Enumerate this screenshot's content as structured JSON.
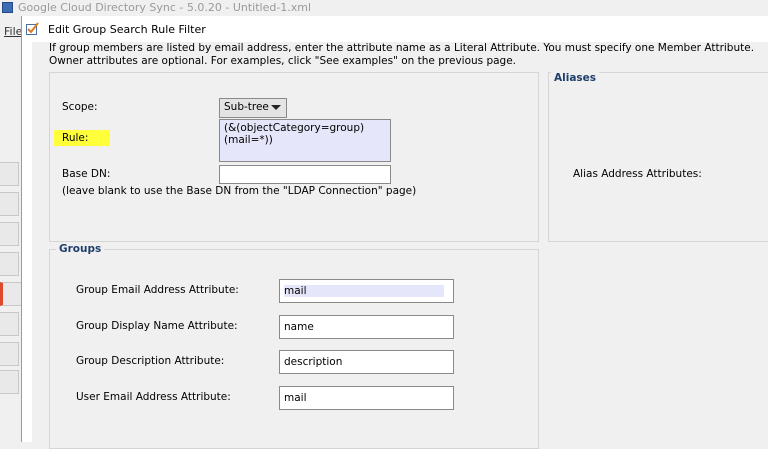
{
  "app": {
    "title": "Google Cloud Directory Sync - 5.0.20 - Untitled-1.xml",
    "menu_file": "File"
  },
  "dialog": {
    "title": "Edit Group Search Rule Filter",
    "intro_line1": "If group members are listed by email address, enter the attribute name as a Literal Attribute. You must specify one Member Attribute.",
    "intro_line2": "Owner attributes are optional. For examples, click \"See examples\" on the previous page."
  },
  "search": {
    "scope_label": "Scope:",
    "scope_value": "Sub-tree",
    "rule_label": "Rule:",
    "rule_value": "(&(objectCategory=group)(mail=*))",
    "base_dn_label": "Base DN:",
    "base_dn_value": "",
    "base_dn_hint": "(leave blank to use the Base DN from the \"LDAP Connection\" page)"
  },
  "aliases": {
    "title": "Aliases",
    "alias_label": "Alias Address Attributes:"
  },
  "groups": {
    "title": "Groups",
    "fields": [
      {
        "label": "Group Email Address Attribute:",
        "value": "mail"
      },
      {
        "label": "Group Display Name Attribute:",
        "value": "name"
      },
      {
        "label": "Group Description Attribute:",
        "value": "description"
      },
      {
        "label": "User Email Address Attribute:",
        "value": "mail"
      }
    ]
  },
  "colors": {
    "highlight": "#ffff3a",
    "group_title": "#1f3f6b"
  }
}
